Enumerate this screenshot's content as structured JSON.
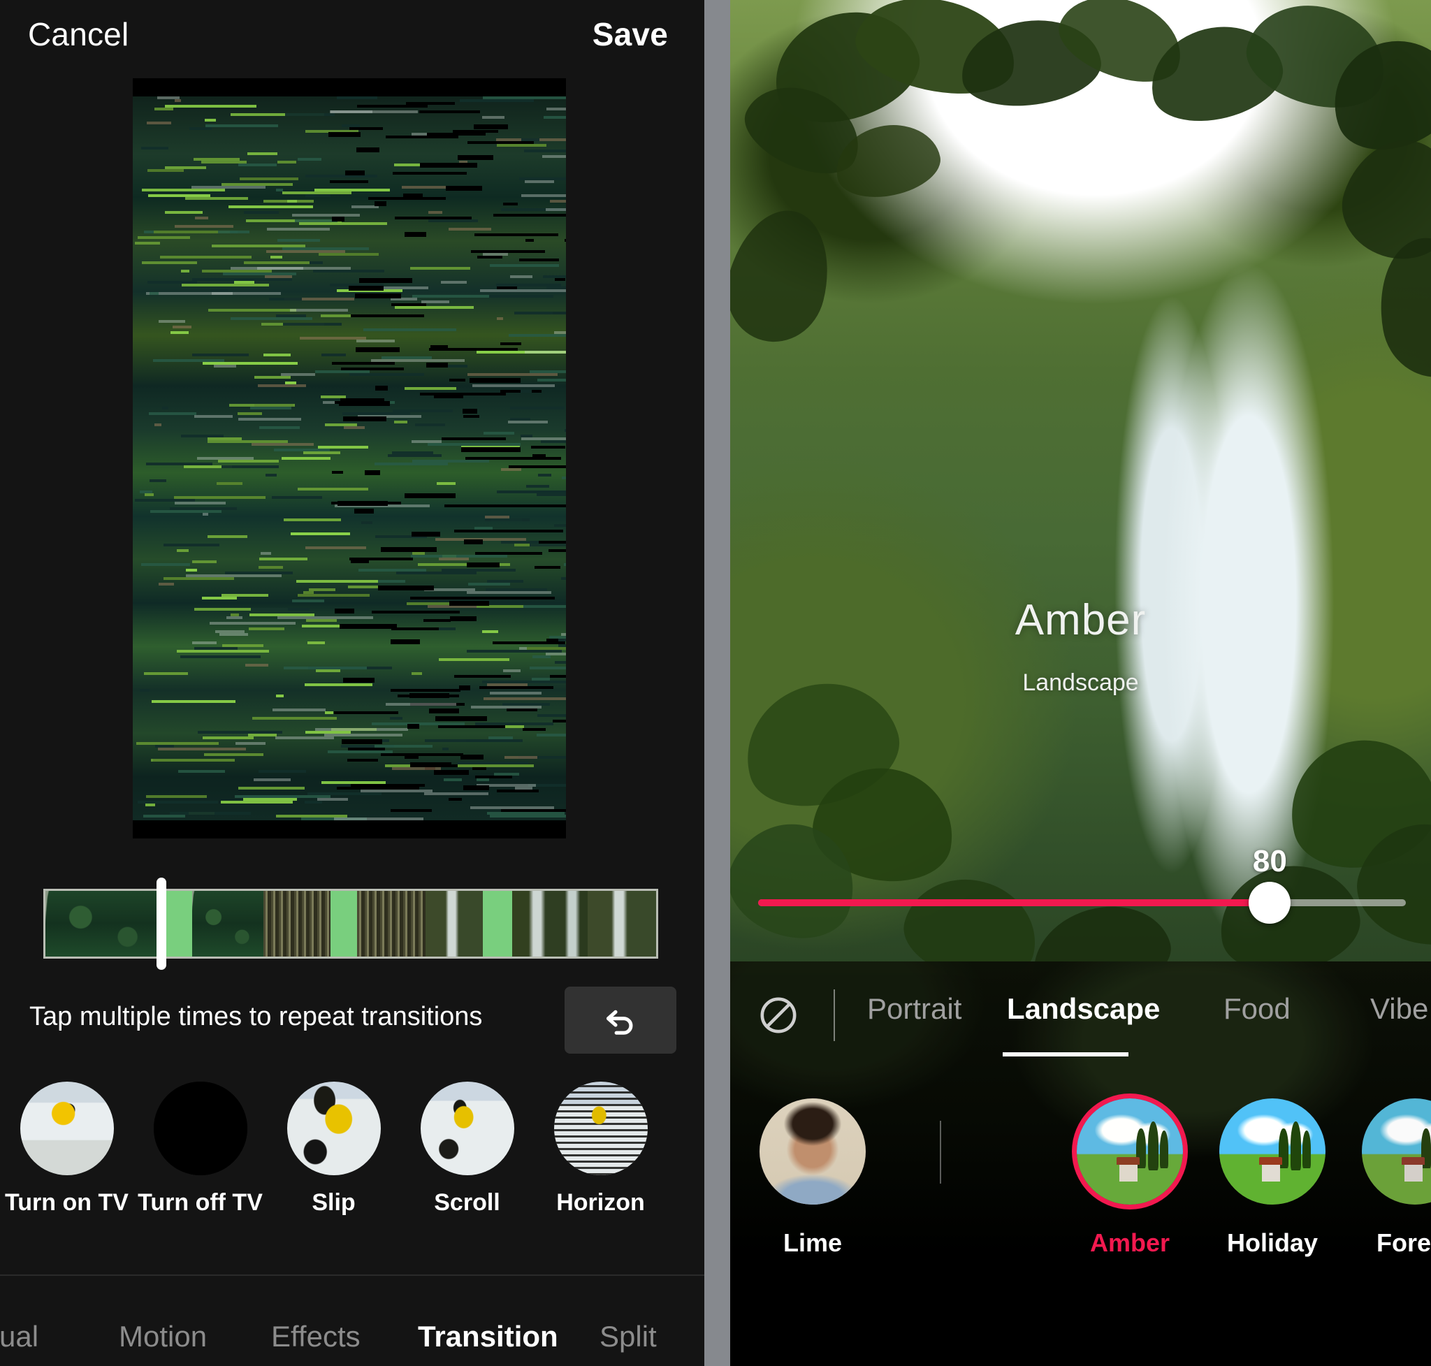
{
  "left_panel": {
    "topbar": {
      "cancel_label": "Cancel",
      "save_label": "Save"
    },
    "preview": {
      "name": "video-preview-frame"
    },
    "timeline": {
      "name": "clip-timeline"
    },
    "hint": {
      "text": "Tap multiple times to repeat transitions",
      "undo_icon": "undo-arrow-icon"
    },
    "transitions": [
      {
        "label": "Turn on TV",
        "thumb": "skier-yellow-jacket",
        "selected": false
      },
      {
        "label": "Turn off TV",
        "thumb": "black-screen",
        "selected": false
      },
      {
        "label": "Slip",
        "thumb": "snow-skier",
        "selected": false
      },
      {
        "label": "Scroll",
        "thumb": "snow-skier",
        "selected": false
      },
      {
        "label": "Horizon",
        "thumb": "snow-streaks",
        "selected": false
      }
    ],
    "bottom_tabs": [
      {
        "label": "sual",
        "active": false
      },
      {
        "label": "Motion",
        "active": false
      },
      {
        "label": "Effects",
        "active": false
      },
      {
        "label": "Transition",
        "active": true
      },
      {
        "label": "Split",
        "active": false
      }
    ]
  },
  "right_panel": {
    "photo": {
      "name": "waterfall-jungle-photo"
    },
    "filter_title": "Amber",
    "filter_subtitle": "Landscape",
    "slider": {
      "value": "80",
      "percent": 79,
      "accent_color": "#f2194f"
    },
    "categories": [
      {
        "label": "Portrait",
        "active": false
      },
      {
        "label": "Landscape",
        "active": true
      },
      {
        "label": "Food",
        "active": false
      },
      {
        "label": "Vibe",
        "active": false
      }
    ],
    "no_filter_icon": "no-filter-circle-slash-icon",
    "filters": [
      {
        "label": "Lime",
        "thumb": "portrait-man",
        "selected": false
      },
      {
        "label": "Amber",
        "thumb": "landscape-hill",
        "selected": true
      },
      {
        "label": "Holiday",
        "thumb": "landscape-hill",
        "selected": false
      },
      {
        "label": "Forest",
        "thumb": "landscape-hill",
        "selected": false
      }
    ]
  },
  "colors": {
    "accent_pink": "#f2194f",
    "transition_marker_green": "#79cf7e",
    "panel_bg": "#141414",
    "divider_gray": "#86898e"
  }
}
